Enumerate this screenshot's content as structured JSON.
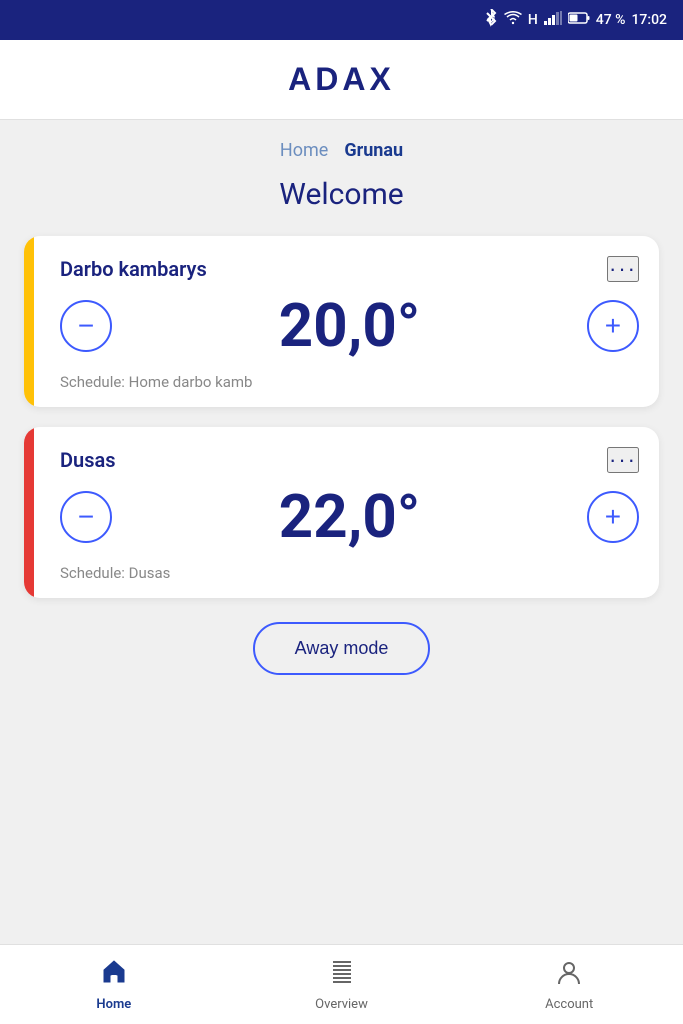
{
  "statusBar": {
    "battery": "47 %",
    "time": "17:02",
    "icons": [
      "bluetooth",
      "wifi",
      "signal",
      "battery"
    ]
  },
  "header": {
    "logo": "ADAX"
  },
  "breadcrumb": {
    "items": [
      {
        "label": "Home",
        "active": false
      },
      {
        "label": "Grunau",
        "active": true
      }
    ]
  },
  "welcome": {
    "title": "Welcome"
  },
  "devices": [
    {
      "name": "Darbo kambarys",
      "temperature": "20,0°",
      "schedule": "Schedule: Home darbo kamb",
      "accentColor": "yellow"
    },
    {
      "name": "Dusas",
      "temperature": "22,0°",
      "schedule": "Schedule: Dusas",
      "accentColor": "orange-red"
    }
  ],
  "awayMode": {
    "label": "Away mode"
  },
  "bottomNav": {
    "items": [
      {
        "label": "Home",
        "active": true,
        "icon": "home"
      },
      {
        "label": "Overview",
        "active": false,
        "icon": "list"
      },
      {
        "label": "Account",
        "active": false,
        "icon": "person"
      }
    ]
  },
  "controls": {
    "decrease": "−",
    "increase": "+"
  }
}
